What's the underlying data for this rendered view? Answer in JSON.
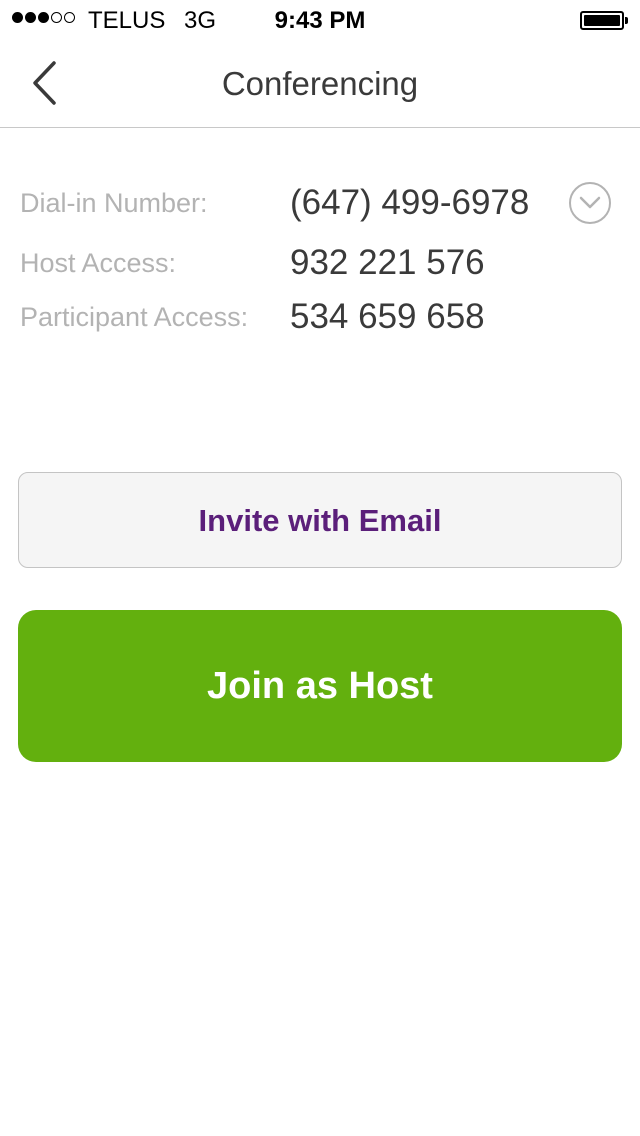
{
  "status_bar": {
    "signal_filled": 3,
    "signal_total": 5,
    "carrier": "TELUS",
    "network": "3G",
    "time": "9:43 PM",
    "battery_level": 1.0
  },
  "nav": {
    "title": "Conferencing",
    "back_icon": "chevron-left-icon"
  },
  "details": {
    "rows": [
      {
        "label": "Dial-in Number:",
        "value": "(647) 499-6978"
      },
      {
        "label": "Host Access:",
        "value": "932 221 576"
      },
      {
        "label": "Participant Access:",
        "value": "534 659 658"
      }
    ],
    "expand_icon": "chevron-down-circle-icon"
  },
  "actions": {
    "invite_label": "Invite with Email",
    "host_label": "Join as Host"
  },
  "colors": {
    "accent_purple": "#5b1f7a",
    "host_green": "#63b00e",
    "label_gray": "#b3b3b3",
    "value_dark": "#3a3a3a"
  }
}
